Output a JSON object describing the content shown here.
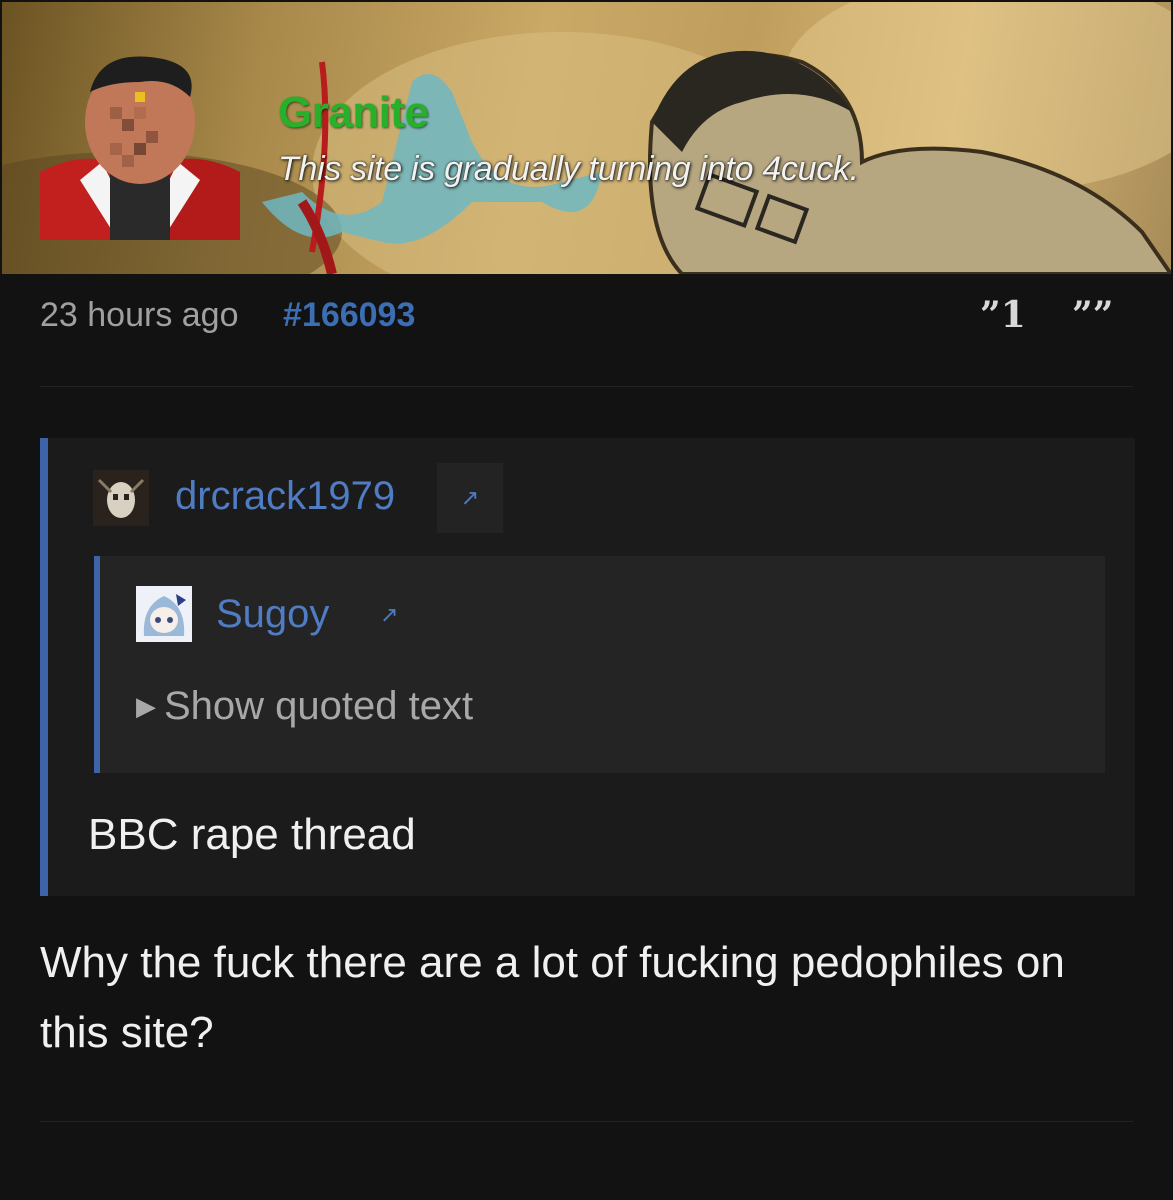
{
  "post": {
    "username": "Granite",
    "tagline": "This site is gradually turning into 4cuck.",
    "timestamp": "23 hours ago",
    "post_id": "#166093",
    "reply_count": "”1",
    "quote_glyph": "””",
    "body": "Why the fuck there are a lot of fucking pedophiles on this site?"
  },
  "quote": {
    "username": "drcrack1979",
    "link_glyph": "↗",
    "text": "BBC rape thread",
    "nested": {
      "username": "Sugoy",
      "link_glyph": "↗",
      "toggle_glyph": "▶",
      "toggle_label": "Show quoted text"
    }
  },
  "colors": {
    "username_green": "#28b02a",
    "link_blue": "#3c6eb4",
    "background": "#121212",
    "quote_border": "#3d64a8"
  }
}
